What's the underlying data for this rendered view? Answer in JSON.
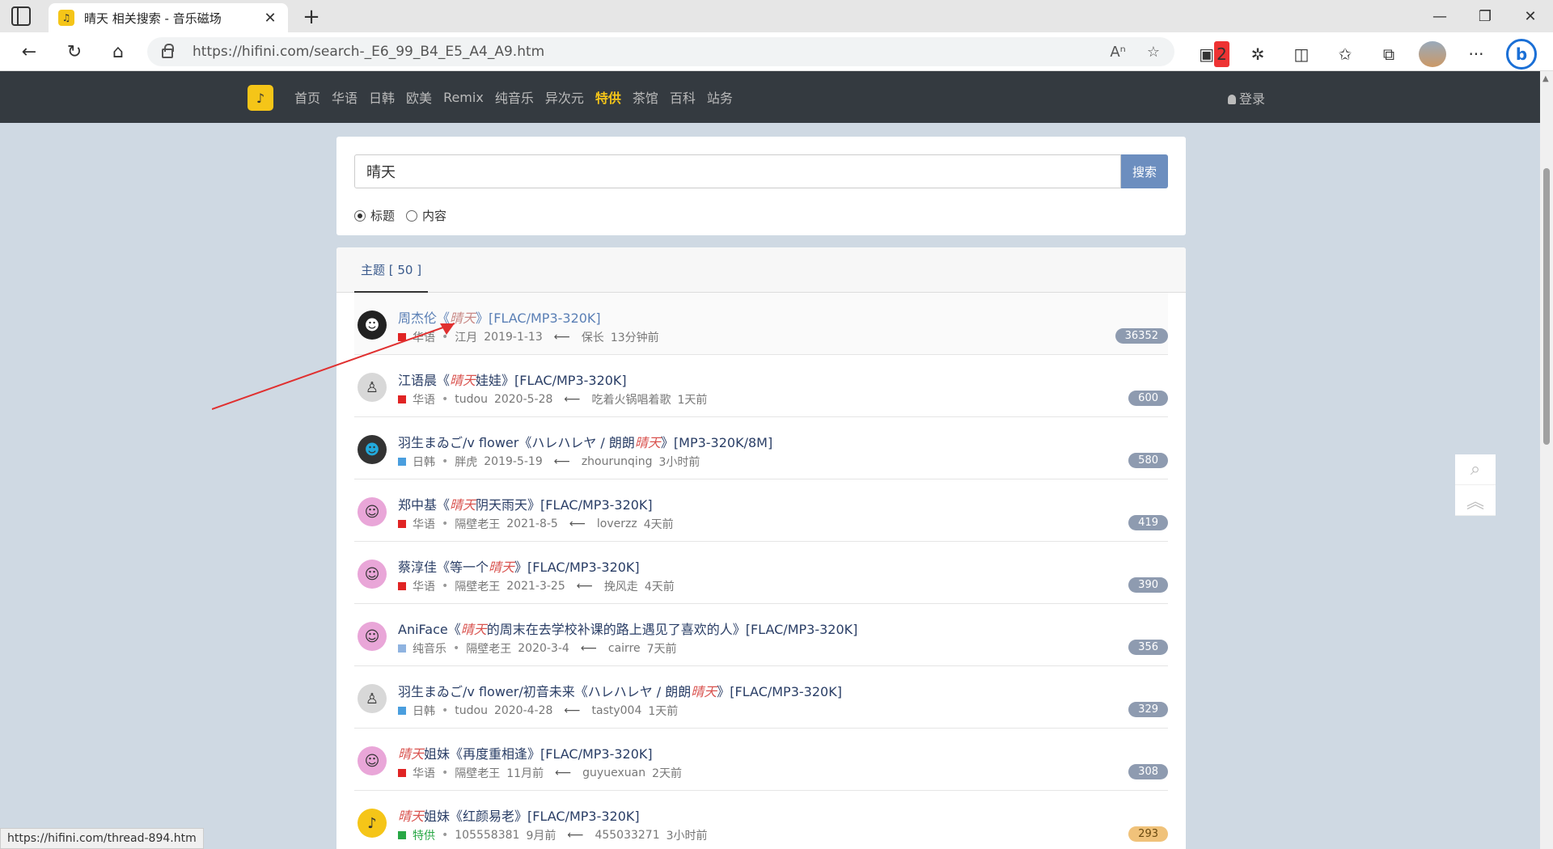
{
  "browser": {
    "tab_title": "晴天 相关搜索 - 音乐磁场",
    "url": "https://hifini.com/search-_E6_99_B4_E5_A4_A9.htm",
    "profile_badge": "2",
    "status_url": "https://hifini.com/thread-894.htm"
  },
  "site": {
    "nav": [
      "首页",
      "华语",
      "日韩",
      "欧美",
      "Remix",
      "纯音乐",
      "异次元",
      "特供",
      "茶馆",
      "百科",
      "站务"
    ],
    "hot_index": 7,
    "login": "登录"
  },
  "search": {
    "query": "晴天",
    "button": "搜索",
    "option_title": "标题",
    "option_content": "内容",
    "selected": "标题"
  },
  "list": {
    "tab_label": "主题 [ 50 ]",
    "rows": [
      {
        "pre": "周杰伦《",
        "kw": "晴天",
        "post": "》[FLAC/MP3-320K]",
        "cat": "华语",
        "tag": "red",
        "author": "江月",
        "date": "2019-1-13",
        "last_user": "保长",
        "last_time": "13分钟前",
        "count": "36352",
        "avatar": "black"
      },
      {
        "pre": "江语晨《",
        "kw": "晴天",
        "post": "娃娃》[FLAC/MP3-320K]",
        "cat": "华语",
        "tag": "red",
        "author": "tudou",
        "date": "2020-5-28",
        "last_user": "吃着火锅唱着歌",
        "last_time": "1天前",
        "count": "600",
        "avatar": "gray"
      },
      {
        "pre": "羽生まゐご/v flower《ハレハレヤ / 朗朗",
        "kw": "晴天",
        "post": "》[MP3-320K/8M]",
        "cat": "日韩",
        "tag": "blue",
        "author": "胖虎",
        "date": "2019-5-19",
        "last_user": "zhourunqing",
        "last_time": "3小时前",
        "count": "580",
        "avatar": "blue"
      },
      {
        "pre": "郑中基《",
        "kw": "晴天",
        "post": "阴天雨天》[FLAC/MP3-320K]",
        "cat": "华语",
        "tag": "red",
        "author": "隔壁老王",
        "date": "2021-8-5",
        "last_user": "loverzz",
        "last_time": "4天前",
        "count": "419",
        "avatar": "pink"
      },
      {
        "pre": "蔡淳佳《等一个",
        "kw": "晴天",
        "post": "》[FLAC/MP3-320K]",
        "cat": "华语",
        "tag": "red",
        "author": "隔壁老王",
        "date": "2021-3-25",
        "last_user": "挽风走",
        "last_time": "4天前",
        "count": "390",
        "avatar": "pink"
      },
      {
        "pre": "AniFace《",
        "kw": "晴天",
        "post": "的周末在去学校补课的路上遇见了喜欢的人》[FLAC/MP3-320K]",
        "cat": "纯音乐",
        "tag": "lightblue",
        "author": "隔壁老王",
        "date": "2020-3-4",
        "last_user": "cairre",
        "last_time": "7天前",
        "count": "356",
        "avatar": "pink"
      },
      {
        "pre": "羽生まゐご/v flower/初音未来《ハレハレヤ / 朗朗",
        "kw": "晴天",
        "post": "》[FLAC/MP3-320K]",
        "cat": "日韩",
        "tag": "blue",
        "author": "tudou",
        "date": "2020-4-28",
        "last_user": "tasty004",
        "last_time": "1天前",
        "count": "329",
        "avatar": "gray"
      },
      {
        "pre": "",
        "kw": "晴天",
        "post": "姐妹《再度重相逢》[FLAC/MP3-320K]",
        "cat": "华语",
        "tag": "red",
        "author": "隔壁老王",
        "date": "11月前",
        "last_user": "guyuexuan",
        "last_time": "2天前",
        "count": "308",
        "avatar": "pink"
      },
      {
        "pre": "",
        "kw": "晴天",
        "post": "姐妹《红颜易老》[FLAC/MP3-320K]",
        "cat": "特供",
        "tag": "green",
        "author": "105558381",
        "date": "9月前",
        "last_user": "455033271",
        "last_time": "3小时前",
        "count": "293",
        "avatar": "yellow"
      }
    ]
  },
  "colors": {
    "nav_bg": "#343a40",
    "accent": "#f5c518",
    "keyword": "#d9534f",
    "search_button": "#6c8ebf",
    "annotation_arrow": "#e03030"
  }
}
